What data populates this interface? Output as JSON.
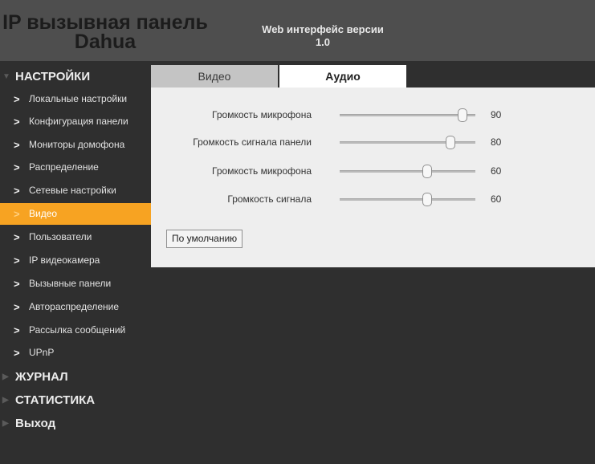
{
  "header": {
    "title": "IP вызывная панель Dahua",
    "subtitle": "Web интерфейс версии 1.0"
  },
  "sidebar": {
    "settings_label": "НАСТРОЙКИ",
    "items": [
      {
        "label": "Локальные настройки"
      },
      {
        "label": "Конфигурация панели"
      },
      {
        "label": "Мониторы домофона"
      },
      {
        "label": "Распределение"
      },
      {
        "label": "Сетевые настройки"
      },
      {
        "label": "Видео",
        "active": true
      },
      {
        "label": "Пользователи"
      },
      {
        "label": "IP видеокамера"
      },
      {
        "label": "Вызывные панели"
      },
      {
        "label": "Автораспределение"
      },
      {
        "label": "Рассылка сообщений"
      },
      {
        "label": "UPnP"
      }
    ],
    "journal_label": "ЖУРНАЛ",
    "stats_label": "СТАТИСТИКА",
    "exit_label": "Выход"
  },
  "tabs": {
    "video": "Видео",
    "audio": "Аудио",
    "active": "audio"
  },
  "audio": {
    "sliders": [
      {
        "label": "Громкость микрофона",
        "value": "90",
        "level": 0.9
      },
      {
        "label": "Громкость сигнала панели",
        "value": "80",
        "level": 0.8
      },
      {
        "label": "Громкость микрофона",
        "value": "60",
        "level": 0.6
      },
      {
        "label": "Громкость сигнала",
        "value": "60",
        "level": 0.6
      }
    ],
    "default_button": "По умолчанию"
  },
  "colors": {
    "accent": "#f7a322",
    "header_bg": "#4e4e4e",
    "sidebar_bg": "#2f2f2f",
    "panel_bg": "#eeeeee"
  },
  "icons": {
    "menu_item": "chevron-right-icon",
    "section_expanded": "triangle-down-icon",
    "section_collapsed": "triangle-right-icon"
  }
}
